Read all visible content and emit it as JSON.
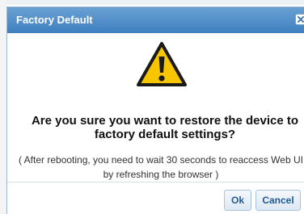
{
  "dialog": {
    "title": "Factory Default",
    "question": "Are you sure you want to restore the device to factory default settings?",
    "note": "( After rebooting, you need to wait 30 seconds to reaccess Web UI by refreshing the browser )",
    "ok_label": "Ok",
    "cancel_label": "Cancel",
    "icons": {
      "warning": "warning-icon",
      "close": "close-icon"
    }
  },
  "colors": {
    "titlebar": "#4a89c8",
    "warning_fill": "#f7c600",
    "button_text": "#1f5a96"
  }
}
